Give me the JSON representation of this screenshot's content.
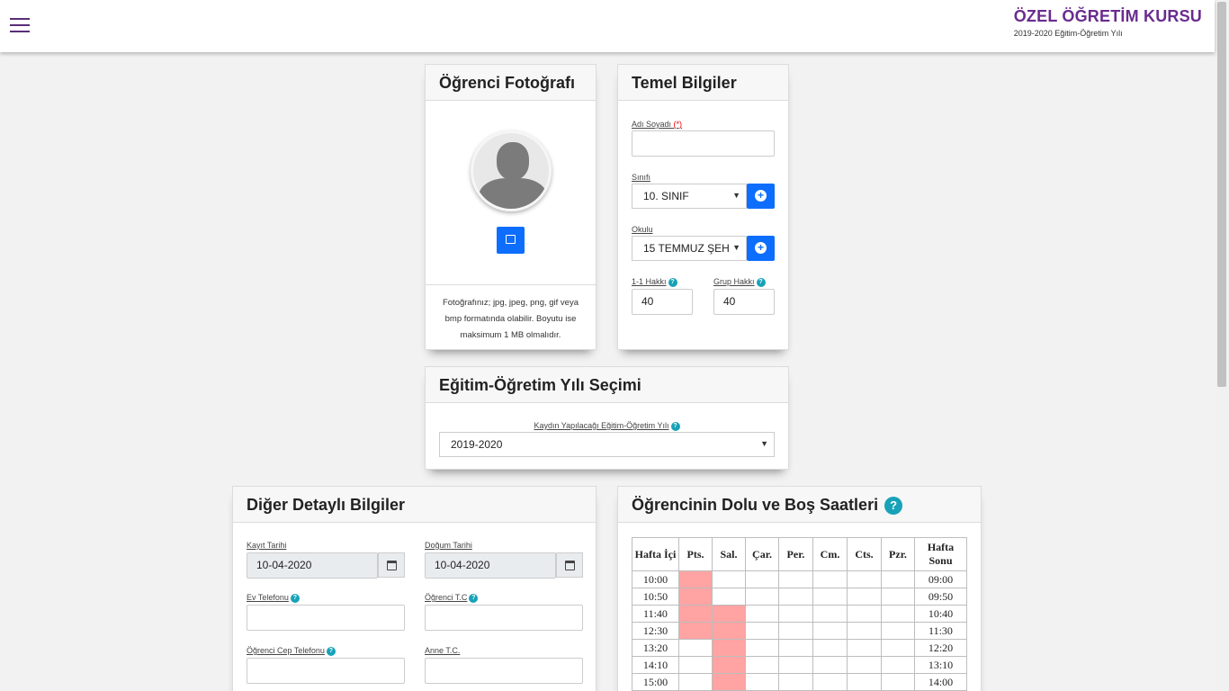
{
  "header": {
    "brand_title": "ÖZEL ÖĞRETİM KURSU",
    "brand_subtitle": "2019-2020 Eğitim-Öğretim Yılı"
  },
  "photo_card": {
    "title": "Öğrenci Fotoğrafı",
    "note": "Fotoğrafınız; jpg, jpeg, png, gif veya bmp formatında olabilir. Boyutu ise maksimum 1 MB olmalıdır."
  },
  "basic_info": {
    "title": "Temel Bilgiler",
    "name_label": "Adı Soyadı",
    "required_mark": "(*)",
    "name_value": "",
    "class_label": "Sınıfı",
    "class_value": "10. SINIF",
    "school_label": "Okulu",
    "school_value": "15 TEMMUZ ŞEH",
    "one_one_label": "1-1 Hakkı",
    "one_one_value": "40",
    "group_label": "Grup Hakkı",
    "group_value": "40"
  },
  "year_card": {
    "title": "Eğitim-Öğretim Yılı Seçimi",
    "label": "Kaydın Yapılacağı Eğitim-Öğretim Yılı",
    "value": "2019-2020"
  },
  "details": {
    "title": "Diğer Detaylı Bilgiler",
    "reg_date_label": "Kayıt Tarihi",
    "reg_date_value": "10-04-2020",
    "birth_date_label": "Doğum Tarihi",
    "birth_date_value": "10-04-2020",
    "home_phone_label": "Ev Telefonu",
    "student_tc_label": "Öğrenci T.C",
    "mobile_label": "Öğrenci Cep Telefonu",
    "mother_tc_label": "Anne T.C."
  },
  "schedule": {
    "title": "Öğrencinin Dolu ve Boş Saatleri",
    "headers": [
      "Hafta İçi",
      "Pts.",
      "Sal.",
      "Çar.",
      "Per.",
      "Cm.",
      "Cts.",
      "Pzr.",
      "Hafta Sonu"
    ],
    "rows": [
      {
        "weekday": "10:00",
        "weekend": "09:00",
        "busy": [
          true,
          false,
          false,
          false,
          false,
          false,
          false
        ]
      },
      {
        "weekday": "10:50",
        "weekend": "09:50",
        "busy": [
          true,
          false,
          false,
          false,
          false,
          false,
          false
        ]
      },
      {
        "weekday": "11:40",
        "weekend": "10:40",
        "busy": [
          true,
          true,
          false,
          false,
          false,
          false,
          false
        ]
      },
      {
        "weekday": "12:30",
        "weekend": "11:30",
        "busy": [
          true,
          true,
          false,
          false,
          false,
          false,
          false
        ]
      },
      {
        "weekday": "13:20",
        "weekend": "12:20",
        "busy": [
          false,
          true,
          false,
          false,
          false,
          false,
          false
        ]
      },
      {
        "weekday": "14:10",
        "weekend": "13:10",
        "busy": [
          false,
          true,
          false,
          false,
          false,
          false,
          false
        ]
      },
      {
        "weekday": "15:00",
        "weekend": "14:00",
        "busy": [
          false,
          true,
          false,
          false,
          false,
          false,
          false
        ]
      }
    ],
    "busy_color": "#ffa3a3"
  },
  "colors": {
    "brand": "#6a2c8f",
    "primary": "#0d6efd",
    "help": "#17a2b8"
  }
}
